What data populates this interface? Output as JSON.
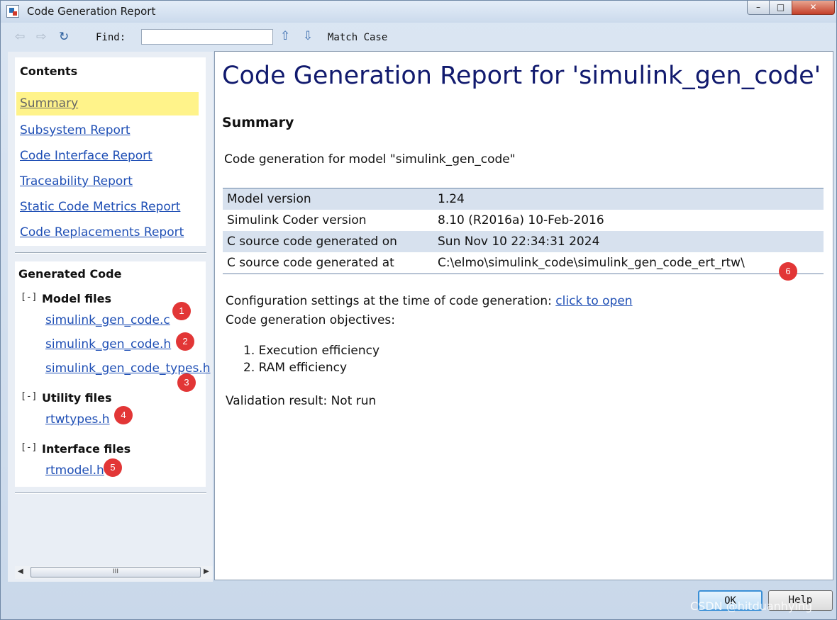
{
  "window": {
    "title": "Code Generation Report",
    "min": "–",
    "max": "□",
    "close": "✕"
  },
  "toolbar": {
    "find_label": "Find:",
    "find_value": "",
    "match_case": "Match Case"
  },
  "contents": {
    "heading": "Contents",
    "links": [
      "Summary",
      "Subsystem Report",
      "Code Interface Report",
      "Traceability Report",
      "Static Code Metrics Report",
      "Code Replacements Report"
    ]
  },
  "generated": {
    "heading": "Generated Code",
    "collapse": "[-]",
    "groups": [
      {
        "label": "Model files",
        "files": [
          "simulink_gen_code.c",
          "simulink_gen_code.h",
          "simulink_gen_code_types.h"
        ]
      },
      {
        "label": "Utility files",
        "files": [
          "rtwtypes.h"
        ]
      },
      {
        "label": "Interface files",
        "files": [
          "rtmodel.h"
        ]
      }
    ]
  },
  "badges": [
    "1",
    "2",
    "3",
    "4",
    "5",
    "6"
  ],
  "scroll": {
    "thumb": "III"
  },
  "report": {
    "title": "Code Generation Report for 'simulink_gen_code'",
    "section": "Summary",
    "intro": "Code generation for model \"simulink_gen_code\"",
    "rows": [
      {
        "k": "Model version",
        "v": "1.24"
      },
      {
        "k": "Simulink Coder version",
        "v": "8.10 (R2016a) 10-Feb-2016"
      },
      {
        "k": "C source code generated on",
        "v": "Sun Nov 10 22:34:31 2024"
      },
      {
        "k": "C source code generated at",
        "v": "C:\\elmo\\simulink_code\\simulink_gen_code_ert_rtw\\"
      }
    ],
    "config_text": "Configuration settings at the time of code generation: ",
    "config_link": "click to open",
    "objectives_label": "Code generation objectives:",
    "objectives": [
      "1.  Execution efficiency",
      "2.  RAM efficiency"
    ],
    "validation": "Validation result: Not run"
  },
  "buttons": {
    "ok": "OK",
    "help": "Help"
  },
  "watermark": "CSDN @hitduanhying"
}
